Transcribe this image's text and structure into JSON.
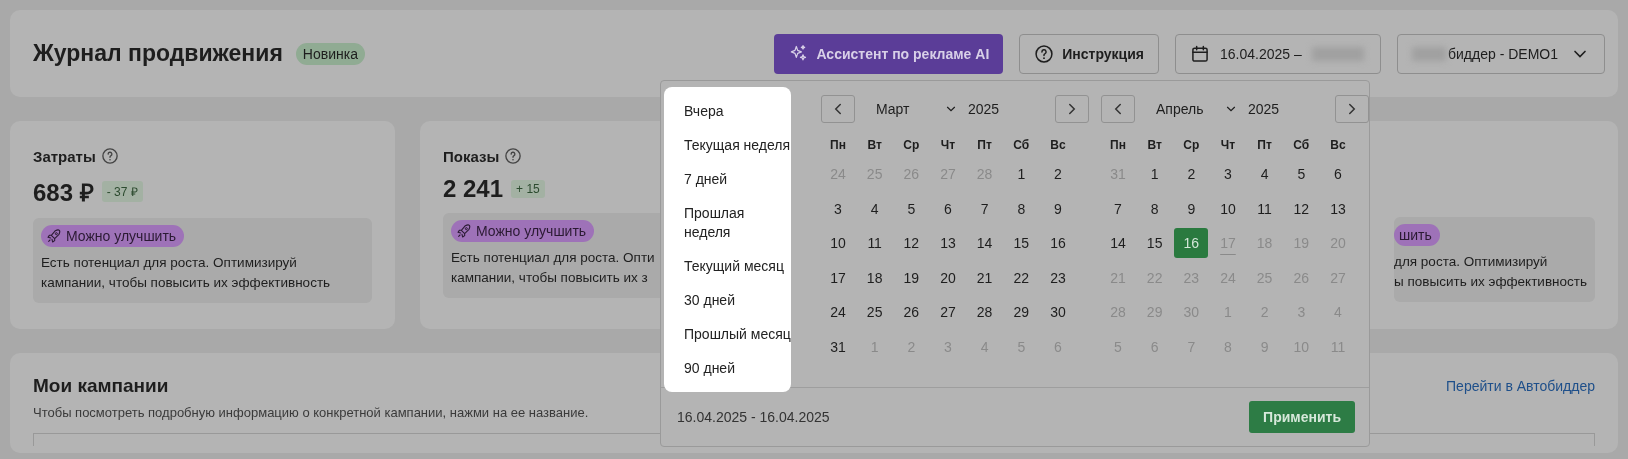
{
  "header": {
    "title": "Журнал продвижения",
    "badge": "Новинка",
    "ai_button": "Ассистент по рекламе AI",
    "help_button": "Инструкция",
    "date_range": "16.04.2025 –",
    "account": "биддер - DEMO1"
  },
  "stats": [
    {
      "title": "Затраты",
      "value": "683 ₽",
      "delta": "- 37  ₽",
      "hint_badge": "Можно улучшить",
      "hint_lines": [
        "Есть потенциал для роста. Оптимизируй",
        "кампании, чтобы повысить их эффективность"
      ]
    },
    {
      "title": "Показы",
      "value": "2 241",
      "delta": "+ 15",
      "hint_badge": "Можно улучшить",
      "hint_lines": [
        "Есть потенциал для роста. Опти",
        "кампании, чтобы повысить их з"
      ]
    },
    {
      "hint_badge": "шить",
      "hint_lines": [
        "для роста. Оптимизируй",
        "ы повысить их эффективность"
      ]
    }
  ],
  "campaigns": {
    "title": "Мои кампании",
    "subtitle": "Чтобы посмотреть подробную информацию о конкретной кампании, нажми на ее название.",
    "link": "Перейти в Автобиддер"
  },
  "picker": {
    "presets": [
      "Вчера",
      "Текущая неделя",
      "7 дней",
      "Прошлая неделя",
      "Текущий месяц",
      "30 дней",
      "Прошлый месяц",
      "90 дней"
    ],
    "months": [
      {
        "month": "Март",
        "year": "2025",
        "weekdays": [
          "Пн",
          "Вт",
          "Ср",
          "Чт",
          "Пт",
          "Сб",
          "Вс"
        ],
        "weeks": [
          [
            {
              "d": "24",
              "muted": true,
              "selected": false,
              "today": false
            },
            {
              "d": "25",
              "muted": true,
              "selected": false,
              "today": false
            },
            {
              "d": "26",
              "muted": true,
              "selected": false,
              "today": false
            },
            {
              "d": "27",
              "muted": true,
              "selected": false,
              "today": false
            },
            {
              "d": "28",
              "muted": true,
              "selected": false,
              "today": false
            },
            {
              "d": "1",
              "muted": false,
              "selected": false,
              "today": false
            },
            {
              "d": "2",
              "muted": false,
              "selected": false,
              "today": false
            }
          ],
          [
            {
              "d": "3",
              "muted": false,
              "selected": false,
              "today": false
            },
            {
              "d": "4",
              "muted": false,
              "selected": false,
              "today": false
            },
            {
              "d": "5",
              "muted": false,
              "selected": false,
              "today": false
            },
            {
              "d": "6",
              "muted": false,
              "selected": false,
              "today": false
            },
            {
              "d": "7",
              "muted": false,
              "selected": false,
              "today": false
            },
            {
              "d": "8",
              "muted": false,
              "selected": false,
              "today": false
            },
            {
              "d": "9",
              "muted": false,
              "selected": false,
              "today": false
            }
          ],
          [
            {
              "d": "10",
              "muted": false,
              "selected": false,
              "today": false
            },
            {
              "d": "11",
              "muted": false,
              "selected": false,
              "today": false
            },
            {
              "d": "12",
              "muted": false,
              "selected": false,
              "today": false
            },
            {
              "d": "13",
              "muted": false,
              "selected": false,
              "today": false
            },
            {
              "d": "14",
              "muted": false,
              "selected": false,
              "today": false
            },
            {
              "d": "15",
              "muted": false,
              "selected": false,
              "today": false
            },
            {
              "d": "16",
              "muted": false,
              "selected": false,
              "today": false
            }
          ],
          [
            {
              "d": "17",
              "muted": false,
              "selected": false,
              "today": false
            },
            {
              "d": "18",
              "muted": false,
              "selected": false,
              "today": false
            },
            {
              "d": "19",
              "muted": false,
              "selected": false,
              "today": false
            },
            {
              "d": "20",
              "muted": false,
              "selected": false,
              "today": false
            },
            {
              "d": "21",
              "muted": false,
              "selected": false,
              "today": false
            },
            {
              "d": "22",
              "muted": false,
              "selected": false,
              "today": false
            },
            {
              "d": "23",
              "muted": false,
              "selected": false,
              "today": false
            }
          ],
          [
            {
              "d": "24",
              "muted": false,
              "selected": false,
              "today": false
            },
            {
              "d": "25",
              "muted": false,
              "selected": false,
              "today": false
            },
            {
              "d": "26",
              "muted": false,
              "selected": false,
              "today": false
            },
            {
              "d": "27",
              "muted": false,
              "selected": false,
              "today": false
            },
            {
              "d": "28",
              "muted": false,
              "selected": false,
              "today": false
            },
            {
              "d": "29",
              "muted": false,
              "selected": false,
              "today": false
            },
            {
              "d": "30",
              "muted": false,
              "selected": false,
              "today": false
            }
          ],
          [
            {
              "d": "31",
              "muted": false,
              "selected": false,
              "today": false
            },
            {
              "d": "1",
              "muted": true,
              "selected": false,
              "today": false
            },
            {
              "d": "2",
              "muted": true,
              "selected": false,
              "today": false
            },
            {
              "d": "3",
              "muted": true,
              "selected": false,
              "today": false
            },
            {
              "d": "4",
              "muted": true,
              "selected": false,
              "today": false
            },
            {
              "d": "5",
              "muted": true,
              "selected": false,
              "today": false
            },
            {
              "d": "6",
              "muted": true,
              "selected": false,
              "today": false
            }
          ]
        ]
      },
      {
        "month": "Апрель",
        "year": "2025",
        "weekdays": [
          "Пн",
          "Вт",
          "Ср",
          "Чт",
          "Пт",
          "Сб",
          "Вс"
        ],
        "weeks": [
          [
            {
              "d": "31",
              "muted": true,
              "selected": false,
              "today": false
            },
            {
              "d": "1",
              "muted": false,
              "selected": false,
              "today": false
            },
            {
              "d": "2",
              "muted": false,
              "selected": false,
              "today": false
            },
            {
              "d": "3",
              "muted": false,
              "selected": false,
              "today": false
            },
            {
              "d": "4",
              "muted": false,
              "selected": false,
              "today": false
            },
            {
              "d": "5",
              "muted": false,
              "selected": false,
              "today": false
            },
            {
              "d": "6",
              "muted": false,
              "selected": false,
              "today": false
            }
          ],
          [
            {
              "d": "7",
              "muted": false,
              "selected": false,
              "today": false
            },
            {
              "d": "8",
              "muted": false,
              "selected": false,
              "today": false
            },
            {
              "d": "9",
              "muted": false,
              "selected": false,
              "today": false
            },
            {
              "d": "10",
              "muted": false,
              "selected": false,
              "today": false
            },
            {
              "d": "11",
              "muted": false,
              "selected": false,
              "today": false
            },
            {
              "d": "12",
              "muted": false,
              "selected": false,
              "today": false
            },
            {
              "d": "13",
              "muted": false,
              "selected": false,
              "today": false
            }
          ],
          [
            {
              "d": "14",
              "muted": false,
              "selected": false,
              "today": false
            },
            {
              "d": "15",
              "muted": false,
              "selected": false,
              "today": false
            },
            {
              "d": "16",
              "muted": false,
              "selected": true,
              "today": false
            },
            {
              "d": "17",
              "muted": true,
              "selected": false,
              "today": true
            },
            {
              "d": "18",
              "muted": true,
              "selected": false,
              "today": false
            },
            {
              "d": "19",
              "muted": true,
              "selected": false,
              "today": false
            },
            {
              "d": "20",
              "muted": true,
              "selected": false,
              "today": false
            }
          ],
          [
            {
              "d": "21",
              "muted": true,
              "selected": false,
              "today": false
            },
            {
              "d": "22",
              "muted": true,
              "selected": false,
              "today": false
            },
            {
              "d": "23",
              "muted": true,
              "selected": false,
              "today": false
            },
            {
              "d": "24",
              "muted": true,
              "selected": false,
              "today": false
            },
            {
              "d": "25",
              "muted": true,
              "selected": false,
              "today": false
            },
            {
              "d": "26",
              "muted": true,
              "selected": false,
              "today": false
            },
            {
              "d": "27",
              "muted": true,
              "selected": false,
              "today": false
            }
          ],
          [
            {
              "d": "28",
              "muted": true,
              "selected": false,
              "today": false
            },
            {
              "d": "29",
              "muted": true,
              "selected": false,
              "today": false
            },
            {
              "d": "30",
              "muted": true,
              "selected": false,
              "today": false
            },
            {
              "d": "1",
              "muted": true,
              "selected": false,
              "today": false
            },
            {
              "d": "2",
              "muted": true,
              "selected": false,
              "today": false
            },
            {
              "d": "3",
              "muted": true,
              "selected": false,
              "today": false
            },
            {
              "d": "4",
              "muted": true,
              "selected": false,
              "today": false
            }
          ],
          [
            {
              "d": "5",
              "muted": true,
              "selected": false,
              "today": false
            },
            {
              "d": "6",
              "muted": true,
              "selected": false,
              "today": false
            },
            {
              "d": "7",
              "muted": true,
              "selected": false,
              "today": false
            },
            {
              "d": "8",
              "muted": true,
              "selected": false,
              "today": false
            },
            {
              "d": "9",
              "muted": true,
              "selected": false,
              "today": false
            },
            {
              "d": "10",
              "muted": true,
              "selected": false,
              "today": false
            },
            {
              "d": "11",
              "muted": true,
              "selected": false,
              "today": false
            }
          ]
        ]
      }
    ],
    "range_text": "16.04.2025 - 16.04.2025",
    "apply": "Применить"
  }
}
